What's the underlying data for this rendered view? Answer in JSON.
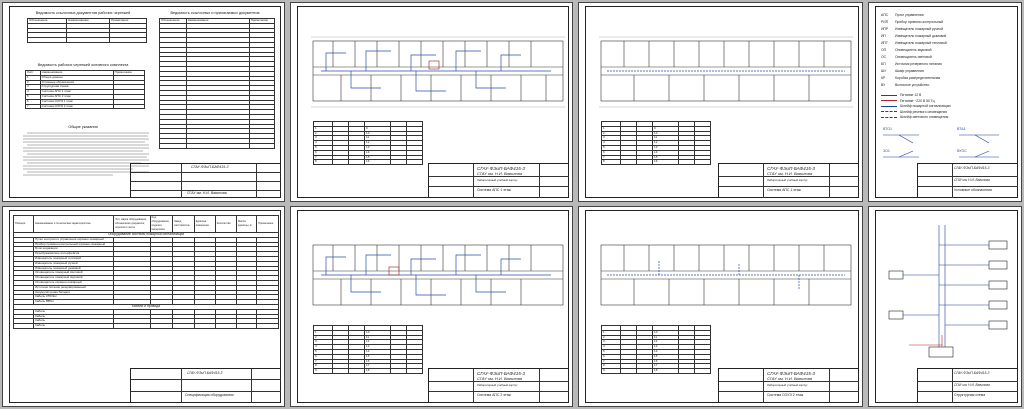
{
  "sheet1": {
    "list_top_title": "Ведомость ссылочных документов рабочих чертежей",
    "list_top_headers": [
      "Обозначение",
      "Наименование",
      "Примечание"
    ],
    "list_mid_title": "Ведомость рабочих чертежей основного комплекта",
    "list_mid_headers": [
      "Лист",
      "Наименование",
      "Примечание"
    ],
    "list_mid_rows": [
      "Общие данные",
      "Условные обозначения",
      "Структурная схема",
      "Система АПС 1 этаж",
      "Система АПС 2 этаж",
      "Система СОУЭ 1 этаж",
      "Система СОУЭ 2 этаж"
    ],
    "right_title": "Ведомость ссылочных и прилагаемых документов",
    "right_headers": [
      "Обозначение",
      "Наименование",
      "Примечание"
    ],
    "notes_title": "Общие указания",
    "stamp_code": "СГАУ-ФЭиП-БАФ415-3",
    "stamp_sub": "СГАУ им. Н.И. Вавилова"
  },
  "sheet2": {
    "stamp_code": "СГАУ-ФЭиП-БАФ415-3",
    "stamp_sub": "СГАУ им. Н.И. Вавилова",
    "stamp_title": "Система АПС 1 этаж",
    "stamp_obj": "Лабораторный учебный корпус"
  },
  "sheet3": {
    "stamp_code": "СГАУ-ФЭиП-БАФ415-3",
    "stamp_sub": "СГАУ им. Н.И. Вавилова",
    "stamp_title": "Система АПС 1 этаж",
    "stamp_obj": "Лабораторный учебный корпус"
  },
  "sheet4": {
    "legend": [
      {
        "sym": "АПС",
        "text": "Пульт управления"
      },
      {
        "sym": "РИП",
        "text": "Прибор приемно-контрольный"
      },
      {
        "sym": "ИПР",
        "text": "Извещатель пожарный ручной"
      },
      {
        "sym": "ИП",
        "text": "Извещатель пожарный дымовой"
      },
      {
        "sym": "ИПТ",
        "text": "Извещатель пожарный тепловой"
      },
      {
        "sym": "ОП",
        "text": "Оповещатель звуковой"
      },
      {
        "sym": "ОС",
        "text": "Оповещатель световой"
      },
      {
        "sym": "БП",
        "text": "Источник резервного питания"
      },
      {
        "sym": "ШУ",
        "text": "Шкаф управления"
      },
      {
        "sym": "КР",
        "text": "Коробка распределительная"
      },
      {
        "sym": "ВУ",
        "text": "Выносное устройство"
      }
    ],
    "cable_legend": [
      "Питание 12 В",
      "Питание ~220 В 50 Гц",
      "Шлейф пожарной сигнализации",
      "Шлейф речевого оповещения",
      "Шлейф светового оповещения"
    ],
    "mount_labels": [
      "ВТО1",
      "ВТА1",
      "ЗО1",
      "ВУОС"
    ],
    "stamp_code": "СГАУ-ФЭиП-БАФ415-3",
    "stamp_sub": "СГАУ им. Н.И. Вавилова",
    "stamp_title": "Условные обозначения"
  },
  "sheet5": {
    "spec_headers": [
      "Позиция",
      "Наименование и техническая характеристика",
      "Тип, марка оборудования, обозначение документа, опросного листа",
      "Код оборудования, изделия, материала",
      "Завод изготовитель",
      "Единица измерения",
      "Количество",
      "Масса единицы, кг",
      "Примечание"
    ],
    "section1": "Оборудование системы пожарной сигнализации",
    "section2": "Кабели и провода",
    "items": [
      "Пульт контроля и управления охранно-пожарный",
      "Прибор приемно-контрольный охранно-пожарный",
      "Блок индикации",
      "Преобразователь интерфейсов",
      "Извещатель пожарный тепловой",
      "Извещатель пожарный ручной",
      "Извещатель пожарный дымовой",
      "Оповещатель пожарный световой",
      "Оповещатель пожарный звуковой",
      "Оповещатель охранно-пожарный",
      "Источник питания резервированный",
      "Аккумуляторная батарея",
      "Кабель КПСЭнг",
      "Кабель ВВГнг"
    ],
    "cables": [
      "Кабель",
      "Кабель",
      "Кабель",
      "Кабель"
    ],
    "stamp_code": "СГАУ-ФЭиП-БАФ415-3",
    "stamp_title": "Спецификация оборудования"
  },
  "sheet6": {
    "stamp_code": "СГАУ-ФЭиП-БАФ415-3",
    "stamp_sub": "СГАУ им. Н.И. Вавилова",
    "stamp_title": "Система АПС 2 этаж",
    "stamp_obj": "Лабораторный учебный корпус"
  },
  "sheet7": {
    "stamp_code": "СГАУ-ФЭиП-БАФ415-3",
    "stamp_sub": "СГАУ им. Н.И. Вавилова",
    "stamp_title": "Система СОУЭ 2 этаж",
    "stamp_obj": "Лабораторный учебный корпус"
  },
  "sheet8": {
    "stamp_code": "СГАУ-ФЭиП-БАФ415-3",
    "stamp_sub": "СГАУ им. Н.И. Вавилова",
    "stamp_title": "Структурная схема"
  }
}
